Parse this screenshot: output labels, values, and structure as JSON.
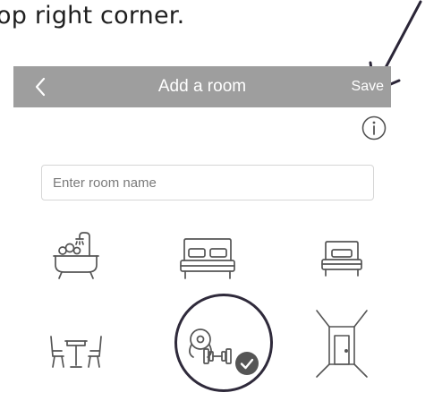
{
  "instruction": {
    "text": "op right corner."
  },
  "header": {
    "title": "Add a room",
    "save_label": "Save",
    "back_icon": "chevron-left-icon"
  },
  "info": {
    "icon": "info-icon"
  },
  "room_name": {
    "placeholder": "Enter room name",
    "value": ""
  },
  "room_types": [
    {
      "icon": "bathtub-icon",
      "selected": false
    },
    {
      "icon": "double-bed-icon",
      "selected": false
    },
    {
      "icon": "single-bed-icon",
      "selected": false
    },
    {
      "icon": "dining-table-icon",
      "selected": false
    },
    {
      "icon": "gym-dumbbell-icon",
      "selected": true
    },
    {
      "icon": "room-door-icon",
      "selected": false
    }
  ],
  "colors": {
    "navbar": "#9e9e9e",
    "icon_stroke": "#555555",
    "highlight_circle": "#2f2a3b",
    "check_badge": "#555555"
  }
}
